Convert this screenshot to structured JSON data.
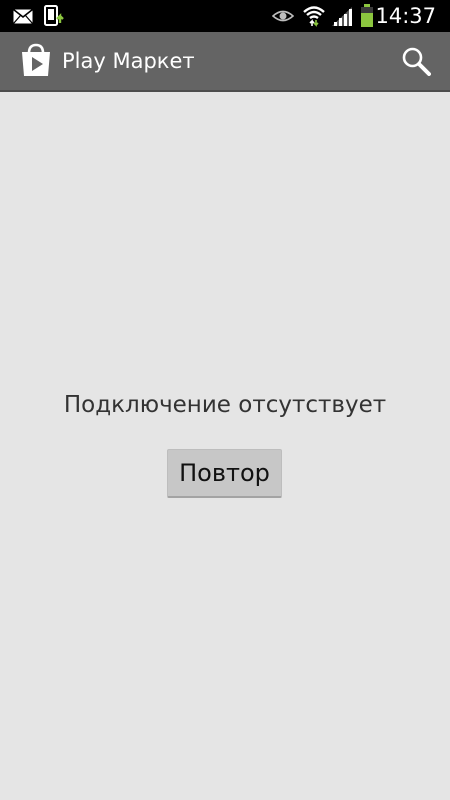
{
  "status_bar": {
    "time": "14:37",
    "icons": [
      "email-icon",
      "phone-update-icon",
      "eye-icon",
      "wifi-icon",
      "signal-icon",
      "battery-icon"
    ],
    "accent_color": "#8cc63f"
  },
  "action_bar": {
    "app_icon": "play-store-icon",
    "title": "Play Маркет",
    "search_icon": "search-icon",
    "background": "#646464"
  },
  "main": {
    "message": "Подключение отсутствует",
    "retry_label": "Повтор"
  }
}
